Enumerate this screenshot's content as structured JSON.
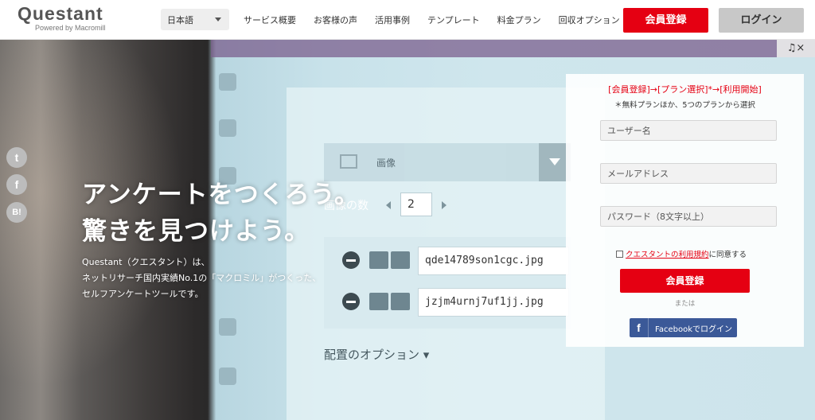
{
  "header": {
    "logo_main": "Questant",
    "logo_sub": "Powered by Macromill",
    "language": "日本語",
    "nav": [
      "サービス概要",
      "お客様の声",
      "活用事例",
      "テンプレート",
      "料金プラン",
      "回収オプション"
    ],
    "register_label": "会員登録",
    "login_label": "ログイン"
  },
  "hero": {
    "headline_line1": "アンケートをつくろう。",
    "headline_line2": "驚きを見つけよう。",
    "sub_line1": "Questant（クエスタント）は、",
    "sub_line2": "ネットリサーチ国内実績No.1の「マクロミル」がつくった、",
    "sub_line3": "セルフアンケートツールです。"
  },
  "mockup": {
    "image_label": "画像",
    "count_label": "画像の数",
    "count_value": "2",
    "file1": "qde14789son1cgc.jpg",
    "file2": "jzjm4urnj7uf1jj.jpg",
    "placement_option": "配置のオプション ▾"
  },
  "social": {
    "twitter": "t",
    "facebook": "f",
    "hatena": "B!"
  },
  "music": {
    "label": "♫×"
  },
  "signup": {
    "steps": "[会員登録]→[プラン選択]*→[利用開始]",
    "note": "＊無料プランほか、5つのプランから選択",
    "username_placeholder": "ユーザー名",
    "email_placeholder": "メールアドレス",
    "password_placeholder": "パスワード（8文字以上）",
    "terms_link": "クエスタントの利用規約",
    "terms_suffix": "に同意する",
    "register_label": "会員登録",
    "or_label": "または",
    "facebook_icon": "f",
    "facebook_label": "Facebookでログイン"
  },
  "colors": {
    "accent": "#e50012",
    "facebook": "#3b5998"
  }
}
